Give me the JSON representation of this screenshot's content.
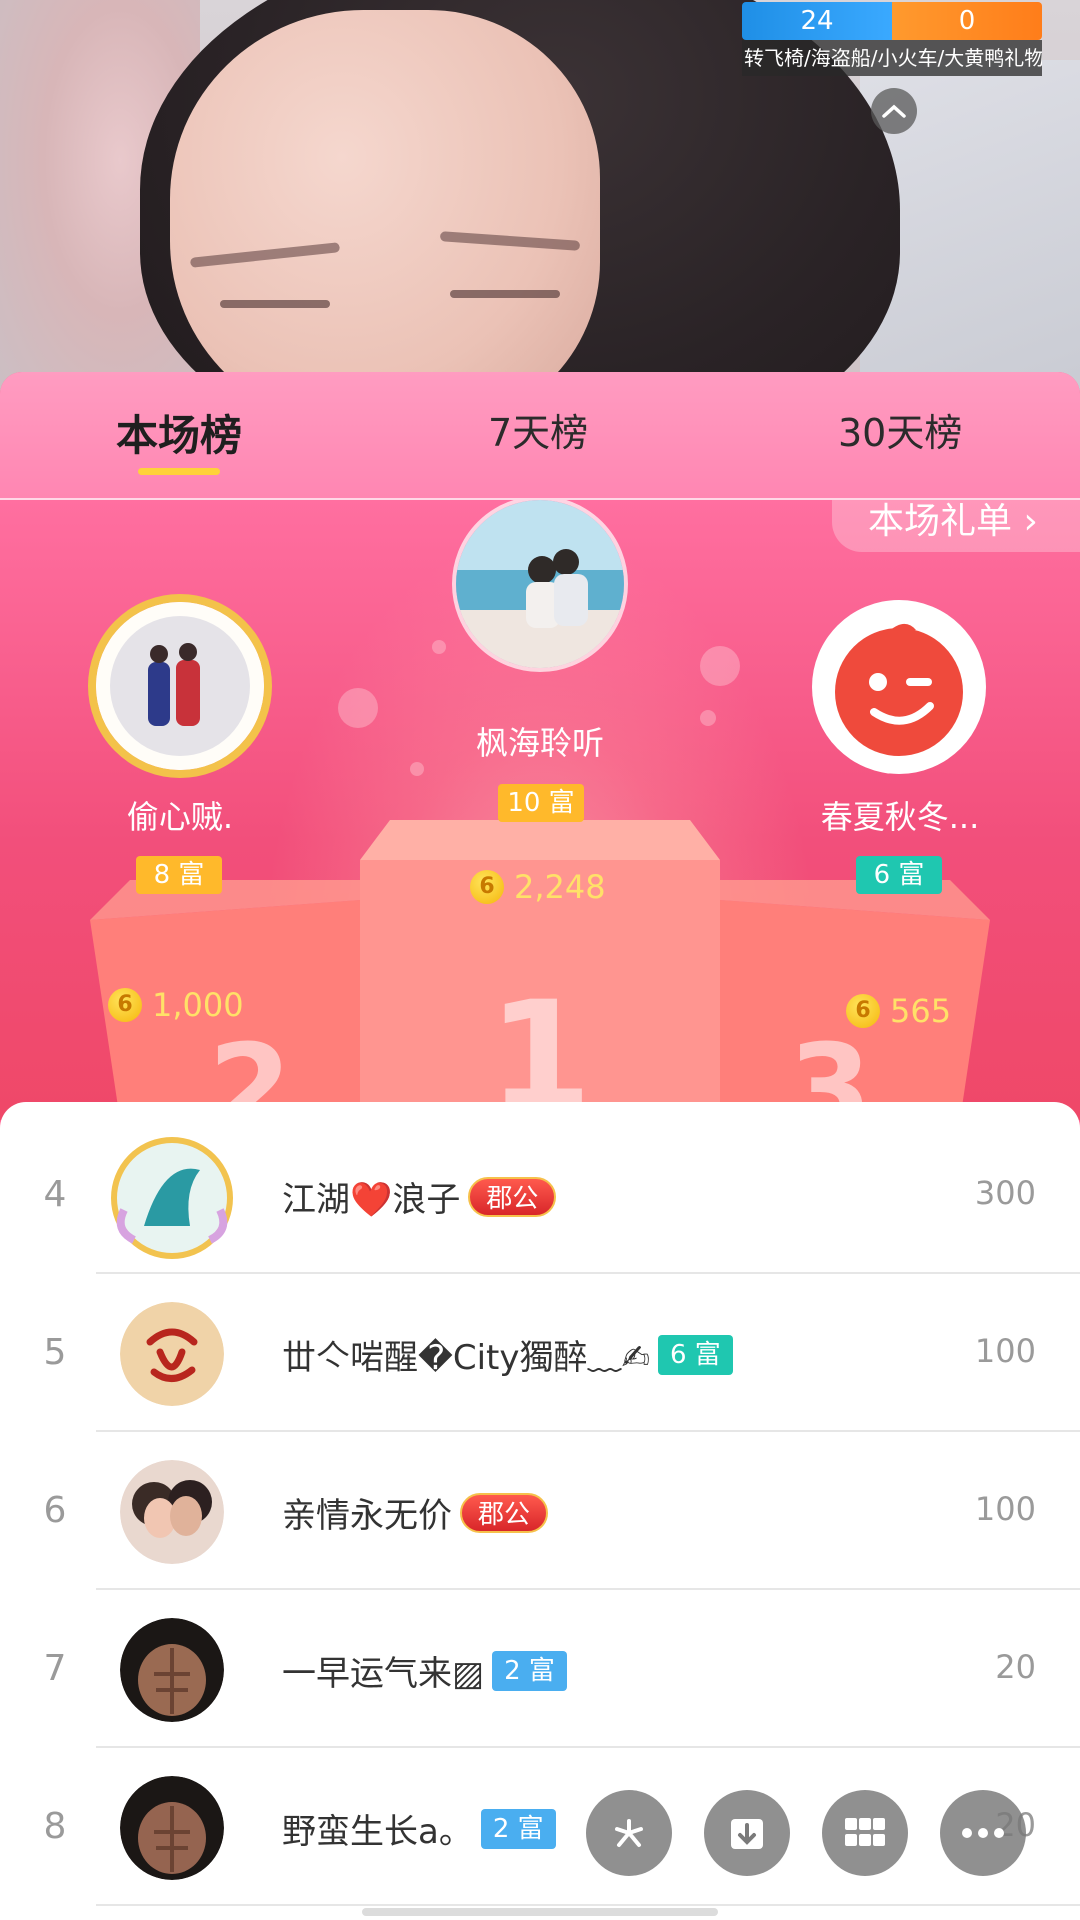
{
  "score_bar": {
    "left": "24",
    "right": "0",
    "caption": "转飞椅/海盗船/小火车/大黄鸭礼物"
  },
  "tabs": [
    {
      "label": "本场榜",
      "active": true
    },
    {
      "label": "7天榜",
      "active": false
    },
    {
      "label": "30天榜",
      "active": false
    }
  ],
  "receipt_link": "本场礼单 ›",
  "podium": {
    "first": {
      "name": "枫海聆听",
      "badge": "10 富",
      "coins": "2,248",
      "block": "1"
    },
    "second": {
      "name": "偷心贼.",
      "badge": "8 富",
      "coins": "1,000",
      "block": "2"
    },
    "third": {
      "name": "春夏秋冬...",
      "badge": "6 富",
      "coins": "565",
      "block": "3"
    }
  },
  "list": [
    {
      "rank": "4",
      "name": "江湖❤️浪子",
      "badge": "郡公",
      "badge_type": "title",
      "score": "300"
    },
    {
      "rank": "5",
      "name": "丗亽啱醒�City獨醉﹏✍",
      "badge": "6 富",
      "badge_type": "teal",
      "score": "100"
    },
    {
      "rank": "6",
      "name": "亲情永无价",
      "badge": "郡公",
      "badge_type": "title",
      "score": "100"
    },
    {
      "rank": "7",
      "name": "一早运气来▨",
      "badge": "2 富",
      "badge_type": "blue",
      "score": "20"
    },
    {
      "rank": "8",
      "name": "野蛮生长a。",
      "badge": "2 富",
      "badge_type": "blue",
      "score": "20"
    }
  ],
  "fab_icons": [
    "sparkle-icon",
    "download-icon",
    "grid-icon",
    "more-icon"
  ],
  "colors": {
    "tab_indicator": "#ffd23a",
    "panel_pink": "#ff5b8a",
    "coin_text": "#ffe168"
  }
}
